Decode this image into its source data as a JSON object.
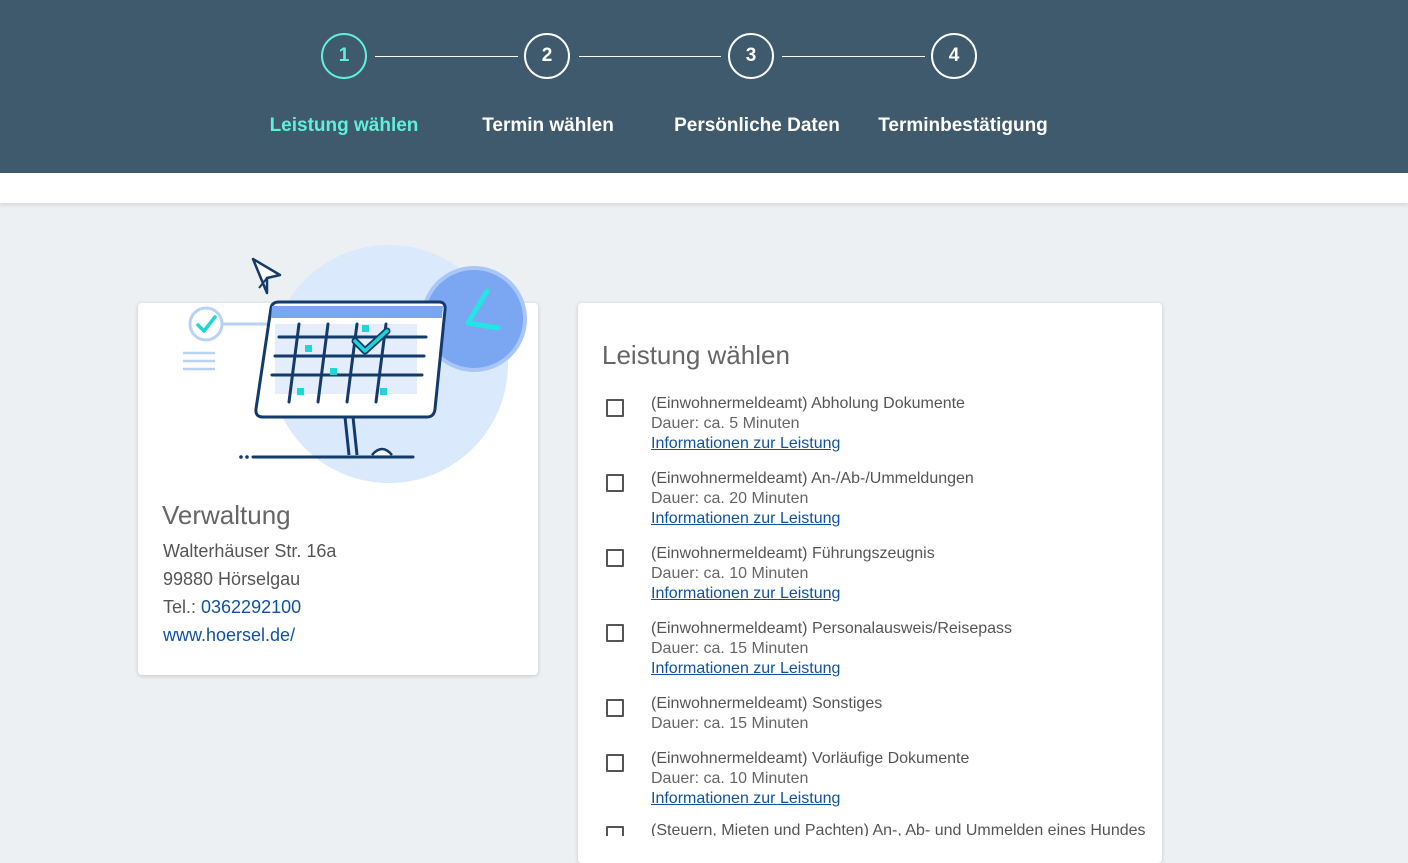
{
  "steps": [
    {
      "number": "1",
      "label": "Leistung wählen"
    },
    {
      "number": "2",
      "label": "Termin wählen"
    },
    {
      "number": "3",
      "label": "Persönliche Daten"
    },
    {
      "number": "4",
      "label": "Terminbestätigung"
    }
  ],
  "active_step": 1,
  "colors": {
    "header_bg": "#3f5a6c",
    "active": "#5ff0d8",
    "link": "#1152a0",
    "page_bg": "#edf0f3"
  },
  "location": {
    "name": "Verwaltung",
    "street": "Walterhäuser Str. 16a",
    "city": "99880 Hörselgau",
    "phone_label": "Tel.: ",
    "phone": "0362292100",
    "website": "www.hoersel.de/"
  },
  "services_section": {
    "title": "Leistung wählen",
    "items": [
      {
        "title": "(Einwohnermeldeamt) Abholung Dokumente",
        "duration": "Dauer: ca. 5 Minuten",
        "info_link": "Informationen zur Leistung"
      },
      {
        "title": "(Einwohnermeldeamt) An-/Ab-/Ummeldungen",
        "duration": "Dauer: ca. 20 Minuten",
        "info_link": "Informationen zur Leistung"
      },
      {
        "title": "(Einwohnermeldeamt) Führungszeugnis",
        "duration": "Dauer: ca. 10 Minuten",
        "info_link": "Informationen zur Leistung"
      },
      {
        "title": "(Einwohnermeldeamt) Personalausweis/Reisepass",
        "duration": "Dauer: ca. 15 Minuten",
        "info_link": "Informationen zur Leistung"
      },
      {
        "title": "(Einwohnermeldeamt) Sonstiges",
        "duration": "Dauer: ca. 15 Minuten",
        "info_link": ""
      },
      {
        "title": "(Einwohnermeldeamt) Vorläufige Dokumente",
        "duration": "Dauer: ca. 10 Minuten",
        "info_link": "Informationen zur Leistung"
      },
      {
        "title": "(Steuern, Mieten und Pachten) An-, Ab- und Ummelden eines Hundes",
        "duration": "",
        "info_link": ""
      }
    ]
  },
  "icons": [
    "calendar-illustration-icon",
    "paper-plane-icon",
    "clock-icon",
    "checkmark-icon",
    "checkbox-icon"
  ]
}
